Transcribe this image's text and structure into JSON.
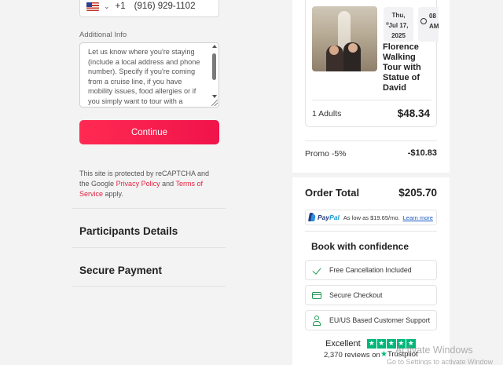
{
  "contact": {
    "country_code": "+1",
    "phone": "(916) 929-1102",
    "additional_info_label": "Additional Info",
    "additional_info_placeholder": "Let us know where you're staying (include a local address and phone number). Specify if you're coming from a cruise line, if you have mobility issues, food allergies or if you simply want to tour with a"
  },
  "continue_label": "Continue",
  "recaptcha": {
    "prefix": "This site is protected by reCAPTCHA and the Google",
    "privacy": "Privacy Policy",
    "and": "and",
    "terms": "Terms of Service",
    "suffix": "apply."
  },
  "sections": {
    "participants": "Participants Details",
    "payment": "Secure Payment"
  },
  "tour": {
    "day": "Thu,",
    "date": "Jul 17,",
    "year": "2025",
    "time_line1": "08",
    "time_line2": "AM",
    "title": "Florence Walking Tour with Statue of David",
    "adults_label": "1 Adults",
    "adults_price": "$48.34"
  },
  "promo": {
    "label": "Promo -5%",
    "value": "-$10.83"
  },
  "order_total": {
    "label": "Order Total",
    "value": "$205.70"
  },
  "paypal": {
    "pay": "Pay",
    "pal": "Pal",
    "text": "As low as $19.65/mo.",
    "link": "Learn more"
  },
  "confidence": {
    "title": "Book with confidence",
    "items": [
      {
        "label": "Free Cancellation Included",
        "icon": "check-icon"
      },
      {
        "label": "Secure Checkout",
        "icon": "credit-card-icon"
      },
      {
        "label": "EU/US Based Customer Support",
        "icon": "user-icon"
      }
    ]
  },
  "trustpilot": {
    "rating_word": "Excellent",
    "reviews": "2,370 reviews on",
    "brand": "Trustpilot",
    "color": "#00b67a"
  },
  "watermark": {
    "title": "Activate Windows",
    "subtitle": "Go to Settings to activate Window"
  },
  "colors": {
    "accent": "#f0134a",
    "link": "#e2233f",
    "success": "#1f9a52"
  }
}
